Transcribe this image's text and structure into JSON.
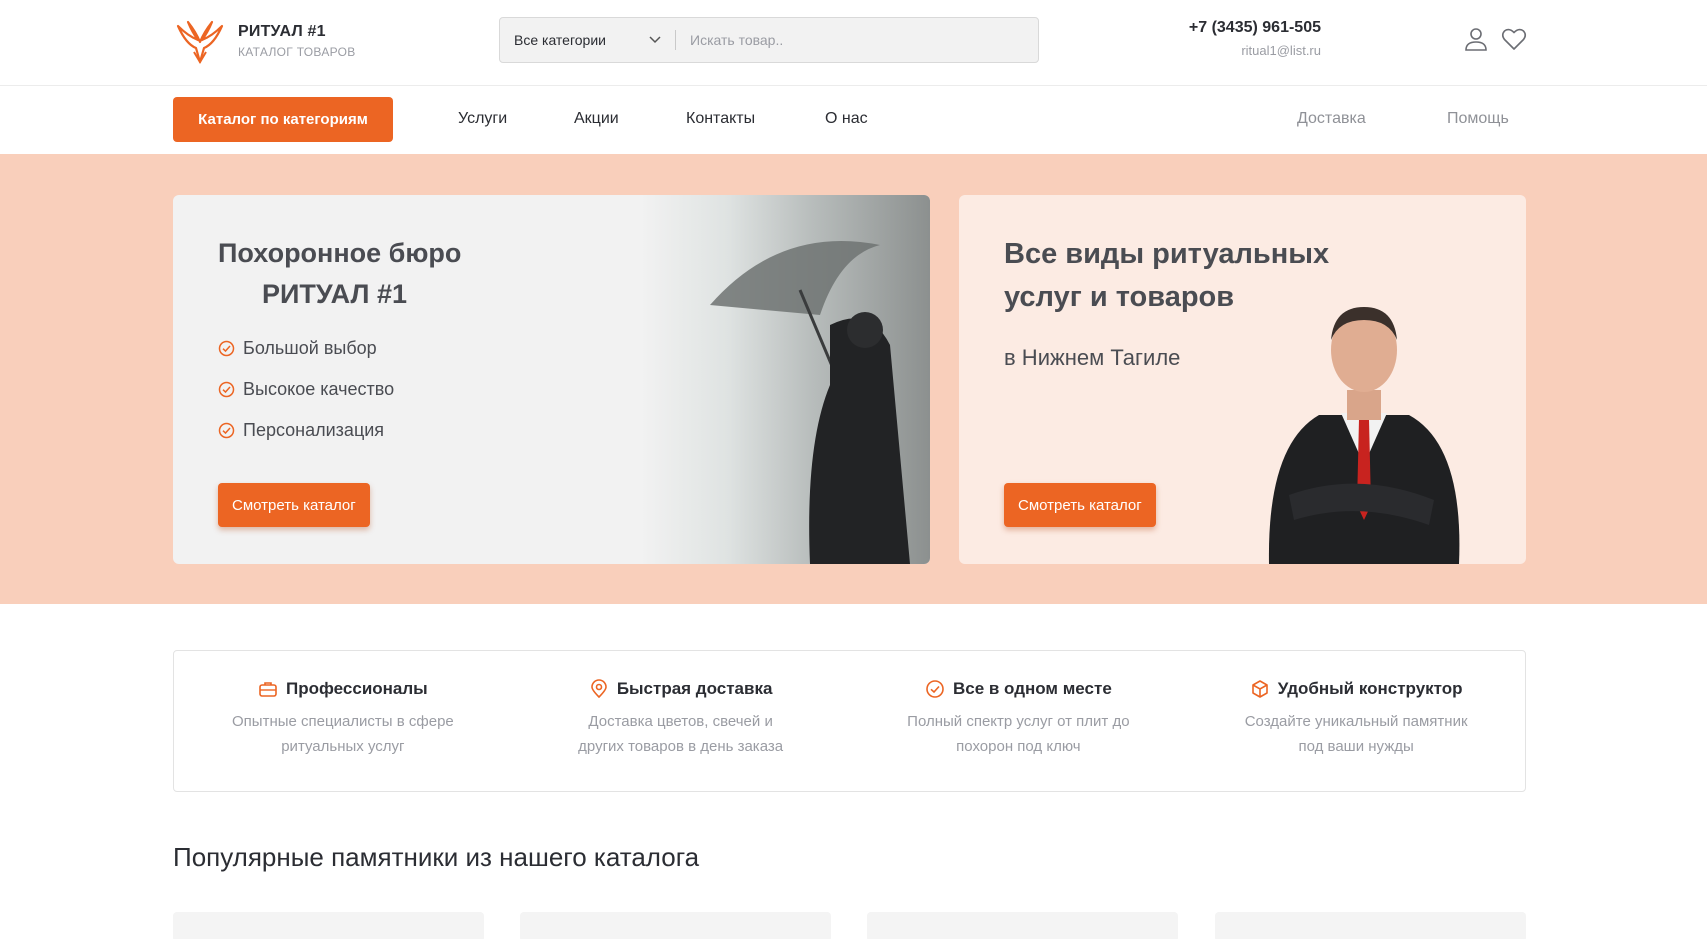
{
  "header": {
    "brand": "РИТУАЛ #1",
    "brand_sub": "КАТАЛОГ ТОВАРОВ",
    "search_category": "Все категории",
    "search_placeholder": "Искать товар..",
    "phone": "+7 (3435) 961-505",
    "email": "ritual1@list.ru",
    "icons": [
      "user-icon",
      "heart-icon"
    ]
  },
  "nav": {
    "catalog_button": "Каталог по категориям",
    "links": [
      "Услуги",
      "Акции",
      "Контакты",
      "О нас"
    ],
    "right_links": [
      "Доставка",
      "Помощь"
    ]
  },
  "hero": {
    "left": {
      "title_line1": "Похоронное бюро",
      "title_line2": "РИТУАЛ #1",
      "checks": [
        "Большой выбор",
        "Высокое качество",
        "Персонализация"
      ],
      "button": "Смотреть каталог"
    },
    "right": {
      "title": "Все виды ритуальных услуг и товаров",
      "city": "в Нижнем Тагиле",
      "button": "Смотреть каталог"
    }
  },
  "features": [
    {
      "icon": "briefcase-icon",
      "title": "Профессионалы",
      "desc_line1": "Опытные специалисты в сфере",
      "desc_line2": "ритуальных услуг"
    },
    {
      "icon": "map-pin-icon",
      "title": "Быстрая доставка",
      "desc_line1": "Доставка цветов, свечей и",
      "desc_line2": "других товаров в день заказа"
    },
    {
      "icon": "check-circle-icon",
      "title": "Все в одном месте",
      "desc_line1": "Полный спектр услуг от плит до",
      "desc_line2": "похорон под ключ"
    },
    {
      "icon": "cube-icon",
      "title": "Удобный конструктор",
      "desc_line1": "Создайте уникальный памятник",
      "desc_line2": "под ваши нужды"
    }
  ],
  "popular_title": "Популярные памятники из нашего каталога",
  "colors": {
    "accent": "#ec6523",
    "hero_bg": "#f9cfbb",
    "card_right_bg": "#fcebe3"
  }
}
